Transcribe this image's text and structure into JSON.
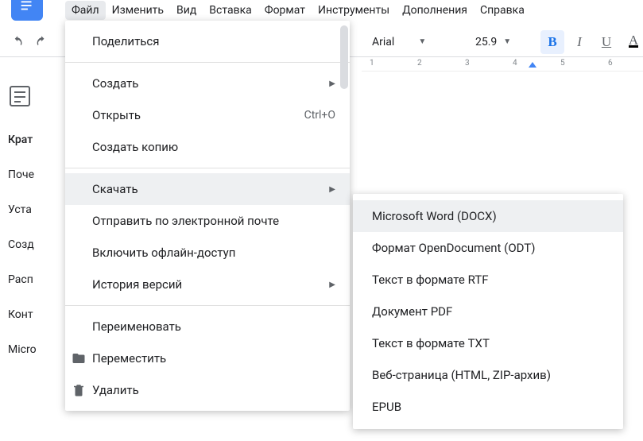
{
  "menubar": [
    "Файл",
    "Изменить",
    "Вид",
    "Вставка",
    "Формат",
    "Инструменты",
    "Дополнения",
    "Справка"
  ],
  "toolbar": {
    "font_family": "Arial",
    "font_size": "25.9",
    "bold": "B",
    "italic": "I",
    "underline": "U"
  },
  "ruler": {
    "marks": [
      "1",
      "2",
      "3",
      "4",
      "5",
      "6"
    ]
  },
  "outline": {
    "items": [
      "Крат",
      "Поче",
      "Уста",
      "Созд",
      "Расп",
      "Конт",
      "Micro"
    ]
  },
  "file_menu": {
    "share": "Поделиться",
    "new": "Создать",
    "open": "Открыть",
    "open_shortcut": "Ctrl+O",
    "make_copy": "Создать копию",
    "download": "Скачать",
    "email": "Отправить по электронной почте",
    "offline": "Включить офлайн-доступ",
    "version_history": "История версий",
    "rename": "Переименовать",
    "move": "Переместить",
    "delete": "Удалить"
  },
  "download_submenu": [
    "Microsoft Word (DOCX)",
    "Формат OpenDocument (ODT)",
    "Текст в формате RTF",
    "Документ PDF",
    "Текст в формате TXT",
    "Веб-страница (HTML, ZIP-архив)",
    "EPUB"
  ]
}
